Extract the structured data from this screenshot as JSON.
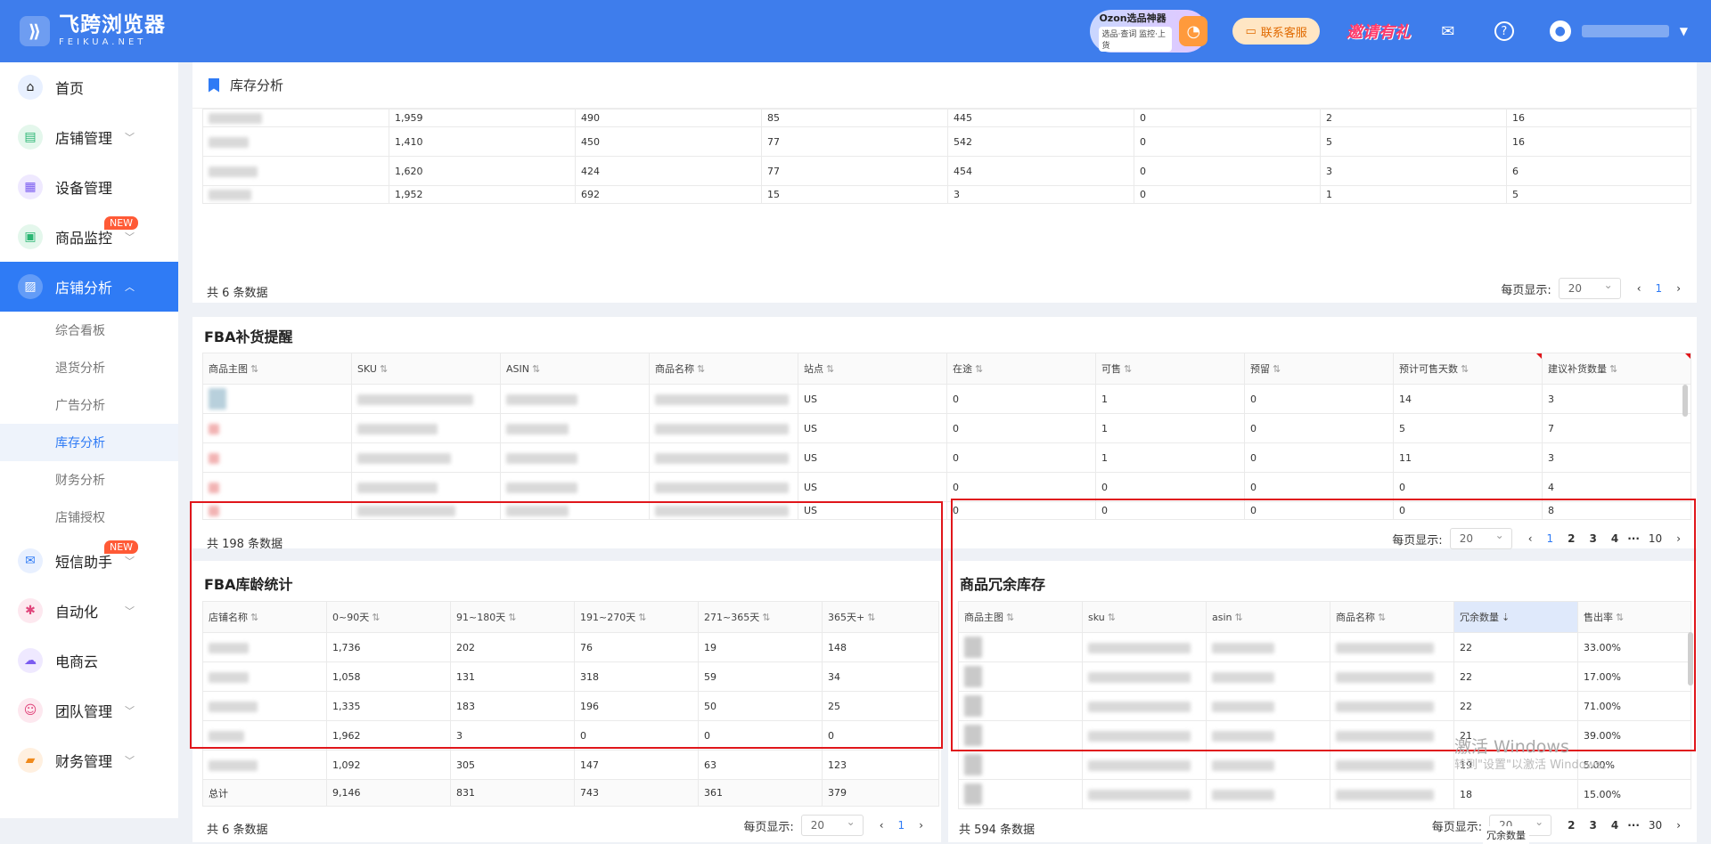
{
  "app": {
    "name_cn": "飞跨浏览器",
    "name_en": "FEIKUA.NET"
  },
  "topbar": {
    "ozon_title": "Ozon选品神器",
    "ozon_sub": "选品·查词 监控·上货",
    "contact": "联系客服",
    "invite": "邀请有礼"
  },
  "sidebar": {
    "items": [
      {
        "label": "首页",
        "icon": "home"
      },
      {
        "label": "店铺管理",
        "icon": "store"
      },
      {
        "label": "设备管理",
        "icon": "device"
      },
      {
        "label": "商品监控",
        "icon": "monitor",
        "badge": "NEW"
      },
      {
        "label": "店铺分析",
        "icon": "analysis",
        "active": true
      },
      {
        "label": "短信助手",
        "icon": "sms",
        "badge": "NEW"
      },
      {
        "label": "自动化",
        "icon": "robot"
      },
      {
        "label": "电商云",
        "icon": "cloud"
      },
      {
        "label": "团队管理",
        "icon": "team"
      },
      {
        "label": "财务管理",
        "icon": "wallet"
      }
    ],
    "sub_items": [
      "综合看板",
      "退货分析",
      "广告分析",
      "库存分析",
      "财务分析",
      "店铺授权"
    ],
    "active_sub": "库存分析"
  },
  "page": {
    "title": "库存分析"
  },
  "top_table": {
    "rows": [
      [
        "",
        "1,959",
        "490",
        "85",
        "445",
        "0",
        "2",
        "16"
      ],
      [
        "",
        "1,410",
        "450",
        "77",
        "542",
        "0",
        "5",
        "16"
      ],
      [
        "",
        "1,620",
        "424",
        "77",
        "454",
        "0",
        "3",
        "6"
      ],
      [
        "",
        "1,952",
        "692",
        "15",
        "3",
        "0",
        "1",
        "5"
      ]
    ],
    "total": "共 6 条数据",
    "page_size_label": "每页显示:",
    "page_size": "20",
    "current_page": "1"
  },
  "fba_replenish": {
    "title": "FBA补货提醒",
    "headers": [
      "商品主图",
      "SKU",
      "ASIN",
      "商品名称",
      "站点",
      "在途",
      "可售",
      "预留",
      "预计可售天数",
      "建议补货数量"
    ],
    "rows": [
      [
        "US",
        "0",
        "1",
        "0",
        "14",
        "3"
      ],
      [
        "US",
        "0",
        "1",
        "0",
        "5",
        "7"
      ],
      [
        "US",
        "0",
        "1",
        "0",
        "11",
        "3"
      ],
      [
        "US",
        "0",
        "0",
        "0",
        "0",
        "4"
      ],
      [
        "US",
        "0",
        "0",
        "0",
        "0",
        "8"
      ]
    ],
    "total": "共 198 条数据",
    "page_size_label": "每页显示:",
    "page_size": "20",
    "pages": [
      "1",
      "2",
      "3",
      "4",
      "···",
      "10"
    ]
  },
  "fba_age": {
    "title": "FBA库龄统计",
    "headers": [
      "店铺名称",
      "0~90天",
      "91~180天",
      "191~270天",
      "271~365天",
      "365天+"
    ],
    "rows": [
      [
        "",
        "1,736",
        "202",
        "76",
        "19",
        "148"
      ],
      [
        "",
        "1,058",
        "131",
        "318",
        "59",
        "34"
      ],
      [
        "",
        "1,335",
        "183",
        "196",
        "50",
        "25"
      ],
      [
        "",
        "1,962",
        "3",
        "0",
        "0",
        "0"
      ],
      [
        "",
        "1,092",
        "305",
        "147",
        "63",
        "123"
      ]
    ],
    "summary": [
      "总计",
      "9,146",
      "831",
      "743",
      "361",
      "379"
    ],
    "total": "共 6 条数据",
    "page_size_label": "每页显示:",
    "page_size": "20",
    "current_page": "1"
  },
  "redundant": {
    "title": "商品冗余库存",
    "headers": [
      "商品主图",
      "sku",
      "asin",
      "商品名称",
      "冗余数量",
      "售出率"
    ],
    "rows": [
      [
        "22",
        "33.00%"
      ],
      [
        "22",
        "17.00%"
      ],
      [
        "22",
        "71.00%"
      ],
      [
        "21",
        "39.00%"
      ],
      [
        "19",
        "5.00%"
      ],
      [
        "18",
        "15.00%"
      ]
    ],
    "total": "共 594 条数据",
    "page_size_label": "每页显示:",
    "page_size": "20",
    "pages": [
      "2",
      "3",
      "4",
      "···",
      "30"
    ],
    "tooltip": "冗余数量"
  },
  "watermark": {
    "line1": "激活 Windows",
    "line2": "转到\"设置\"以激活 Windows。"
  },
  "colors": {
    "primary": "#2f7bf5",
    "topbar": "#3e7dec",
    "highlight": "#e0161b"
  }
}
